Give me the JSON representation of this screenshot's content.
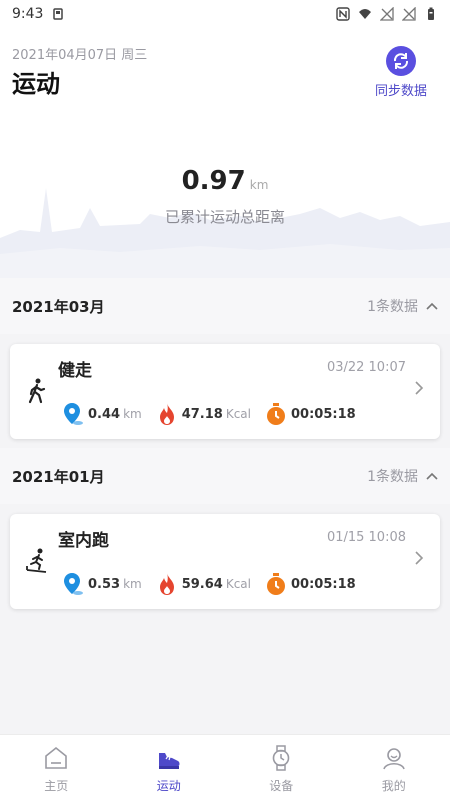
{
  "status_bar": {
    "time": "9:43"
  },
  "header": {
    "date": "2021年04月07日 周三",
    "title": "运动",
    "sync_label": "同步数据"
  },
  "summary": {
    "total_distance": "0.97",
    "unit": "km",
    "label": "已累计运动总距离"
  },
  "sections": [
    {
      "month": "2021年03月",
      "count": "1条数据",
      "records": [
        {
          "name": "健走",
          "datetime": "03/22 10:07",
          "distance": "0.44",
          "distance_unit": "km",
          "calories": "47.18",
          "calories_unit": "Kcal",
          "duration": "00:05:18"
        }
      ]
    },
    {
      "month": "2021年01月",
      "count": "1条数据",
      "records": [
        {
          "name": "室内跑",
          "datetime": "01/15 10:08",
          "distance": "0.53",
          "distance_unit": "km",
          "calories": "59.64",
          "calories_unit": "Kcal",
          "duration": "00:05:18"
        }
      ]
    }
  ],
  "tabbar": {
    "tabs": [
      {
        "label": "主页",
        "icon": "home-icon"
      },
      {
        "label": "运动",
        "icon": "sneaker-icon"
      },
      {
        "label": "设备",
        "icon": "watch-icon"
      },
      {
        "label": "我的",
        "icon": "profile-icon"
      }
    ],
    "active": "运动"
  },
  "colors": {
    "accent": "#5a4fe0",
    "location": "#1e8fe0",
    "fire": "#e5452f",
    "timer": "#f07d1a"
  }
}
